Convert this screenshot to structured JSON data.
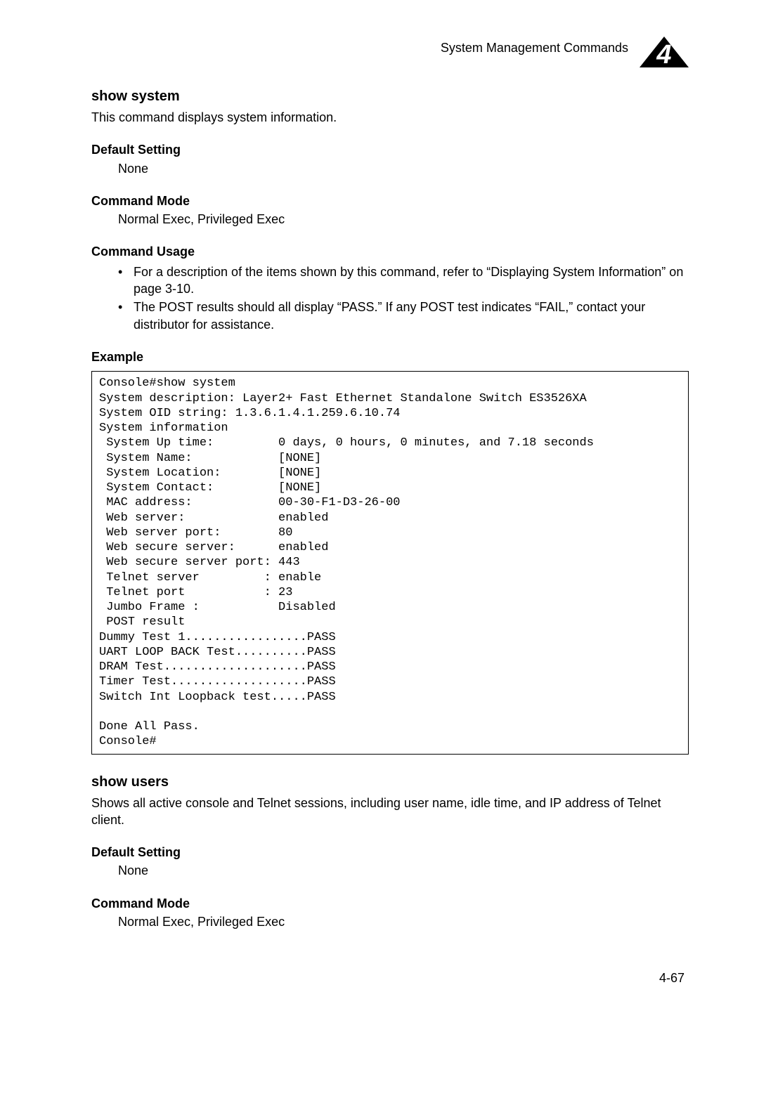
{
  "header": {
    "title": "System Management Commands",
    "chapter_number": "4"
  },
  "sections": [
    {
      "title": "show system",
      "description": "This command displays system information.",
      "subsections": [
        {
          "heading": "Default Setting",
          "body": "None"
        },
        {
          "heading": "Command Mode",
          "body": "Normal Exec, Privileged Exec"
        },
        {
          "heading": "Command Usage",
          "bullets": [
            "For a description of the items shown by this command, refer to “Displaying System Information” on page 3-10.",
            "The POST results should all display “PASS.” If any POST test indicates “FAIL,” contact your distributor for assistance."
          ]
        },
        {
          "heading": "Example",
          "code": "Console#show system\nSystem description: Layer2+ Fast Ethernet Standalone Switch ES3526XA\nSystem OID string: 1.3.6.1.4.1.259.6.10.74\nSystem information\n System Up time:         0 days, 0 hours, 0 minutes, and 7.18 seconds\n System Name:            [NONE]\n System Location:        [NONE]\n System Contact:         [NONE]\n MAC address:            00-30-F1-D3-26-00\n Web server:             enabled\n Web server port:        80\n Web secure server:      enabled\n Web secure server port: 443\n Telnet server         : enable\n Telnet port           : 23\n Jumbo Frame :           Disabled\n POST result\nDummy Test 1.................PASS\nUART LOOP BACK Test..........PASS\nDRAM Test....................PASS\nTimer Test...................PASS\nSwitch Int Loopback test.....PASS\n\nDone All Pass.\nConsole#"
        }
      ]
    },
    {
      "title": "show users",
      "description": "Shows all active console and Telnet sessions, including user name, idle time, and IP address of Telnet client.",
      "subsections": [
        {
          "heading": "Default Setting",
          "body": "None"
        },
        {
          "heading": "Command Mode",
          "body": "Normal Exec, Privileged Exec"
        }
      ]
    }
  ],
  "page_number": "4-67"
}
